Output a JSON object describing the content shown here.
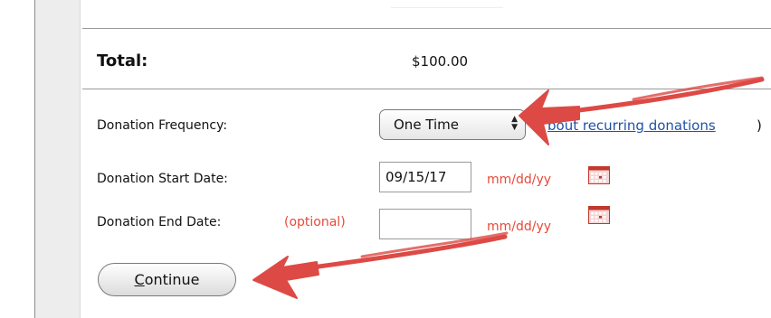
{
  "summary": {
    "total_label": "Total:",
    "total_value": "$100.00"
  },
  "form": {
    "frequency": {
      "label": "Donation Frequency:",
      "selected": "One Time",
      "link_text": "About recurring donations",
      "link_visible_text": "bout recurring donations",
      "link_close_paren": ")"
    },
    "start_date": {
      "label": "Donation Start Date:",
      "value": "09/15/17",
      "format_hint": "mm/dd/yy"
    },
    "end_date": {
      "label": "Donation End Date:",
      "optional_text": "(optional)",
      "value": "",
      "format_hint": "mm/dd/yy"
    },
    "continue_button": {
      "first_letter": "C",
      "rest": "ontinue"
    }
  },
  "icons": {
    "calendar": "calendar-icon",
    "select_arrows": "up-down-arrows-icon"
  },
  "colors": {
    "accent_red": "#e8493b",
    "link_blue": "#1f53a6",
    "annotation_arrow_red": "#dd4a45"
  }
}
